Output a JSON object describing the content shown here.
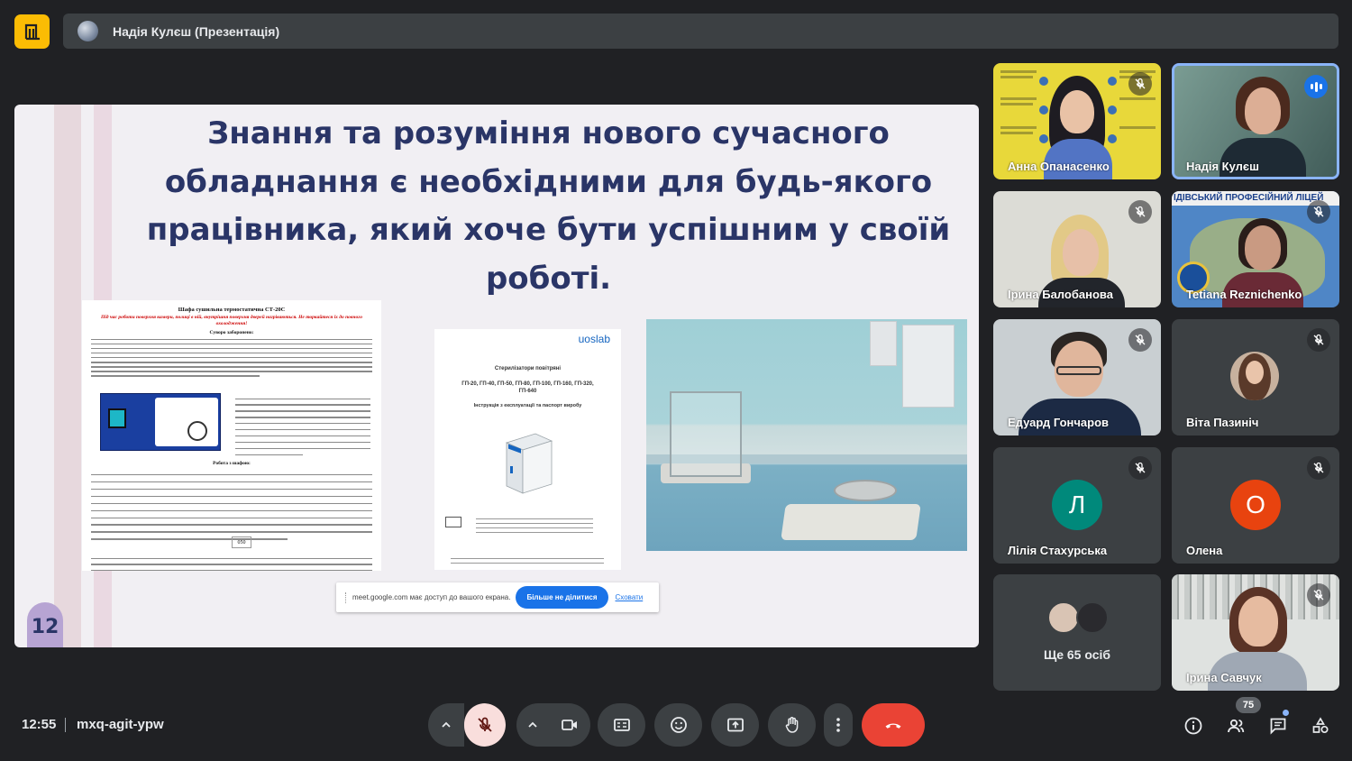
{
  "header": {
    "presenter_label": "Надія Кулєш (Презентація)"
  },
  "slide": {
    "title": "Знання та розуміння нового сучасного обладнання є необхідними для будь-якого працівника, який хоче бути успішним у своїй роботі.",
    "page_number": "12",
    "doc1": {
      "title": "Шафа сушильна термостатична СТ-20С",
      "warning": "Під час роботи поверхня камери, полиці в ній, внутрішня поверхня дверей нагріваються. Не торкайтеся їх до повного охолодження!",
      "section1": "Суворо заборонено:",
      "section2": "Робота з шафою:",
      "code_value": "050"
    },
    "doc2": {
      "brand": "uoslab",
      "title": "Стерилізатори повітряні",
      "models": "ГП-20, ГП-40, ГП-50, ГП-80, ГП-100, ГП-160, ГП-320, ГП-640",
      "subtitle": "Інструкція з експлуатації та паспорт виробу"
    }
  },
  "share_banner": {
    "message": "meet.google.com має доступ до вашого екрана.",
    "stop_label": "Більше не ділитися",
    "hide_label": "Сховати"
  },
  "participants": [
    {
      "name": "Анна Опанасенко",
      "state": "muted"
    },
    {
      "name": "Надія Кулєш",
      "state": "speaking"
    },
    {
      "name": "Ірина Балобанова",
      "state": "muted"
    },
    {
      "name": "Tetiana Reznichenko",
      "state": "muted"
    },
    {
      "name": "Едуард Гончаров",
      "state": "muted"
    },
    {
      "name": "Віта Пазиніч",
      "state": "muted"
    },
    {
      "name": "Лілія Стахурська",
      "initial": "Л",
      "color": "#00897b",
      "state": "muted"
    },
    {
      "name": "Олена",
      "initial": "О",
      "color": "#e8430f",
      "state": "muted"
    },
    {
      "more_label": "Ще 65 осіб"
    },
    {
      "name": "Ірина Савчук",
      "state": "muted"
    }
  ],
  "tile3_banner": "ІДІВСЬКИЙ ПРОФЕСІЙНИЙ ЛІЦЕЙ",
  "footer": {
    "time": "12:55",
    "meeting_code": "mxq-agit-ypw",
    "participant_count": "75"
  },
  "icons": [
    "app-logo-icon",
    "mic-off-icon",
    "camera-icon",
    "captions-icon",
    "emoji-icon",
    "present-icon",
    "raise-hand-icon",
    "more-options-icon",
    "hang-up-icon",
    "info-icon",
    "people-icon",
    "chat-icon",
    "activities-icon"
  ],
  "colors": {
    "accent": "#8ab4f8",
    "danger": "#ea4335",
    "mic_off_bg": "#f9dedc",
    "brand_yellow": "#fbbc04",
    "blue_button": "#1a73e8"
  }
}
